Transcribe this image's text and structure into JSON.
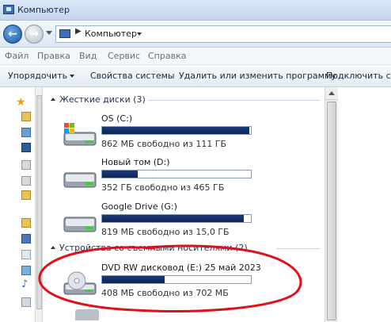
{
  "window": {
    "title": "Компьютер"
  },
  "address": {
    "crumb": "Компьютер"
  },
  "menu": [
    "Файл",
    "Правка",
    "Вид",
    "Сервис",
    "Справка"
  ],
  "commands": {
    "organize": "Упорядочить",
    "system_properties": "Свойства системы",
    "uninstall": "Удалить или изменить программу",
    "connect": "Подключить сет"
  },
  "groups": {
    "hard_disks": "Жесткие диски (3)",
    "removable": "Устройства со съемными носителями (2)"
  },
  "drives": [
    {
      "name": "OS (C:)",
      "free_text": "862 МБ свободно из 111 ГБ",
      "used_fraction": 0.99,
      "icon": "windows-drive-icon"
    },
    {
      "name": "Новый том (D:)",
      "free_text": "352 ГБ свободно из 465 ГБ",
      "used_fraction": 0.24,
      "icon": "hard-drive-icon"
    },
    {
      "name": "Google Drive (G:)",
      "free_text": "819 МБ свободно из 15,0 ГБ",
      "used_fraction": 0.95,
      "icon": "hard-drive-icon"
    },
    {
      "name": "DVD RW дисковод (E:) 25 май 2023",
      "free_text": "408 МБ свободно из 702 МБ",
      "used_fraction": 0.42,
      "icon": "dvd-drive-icon"
    }
  ],
  "colors": {
    "usage_bar": "#0d2358",
    "annotation": "#e0101a"
  }
}
